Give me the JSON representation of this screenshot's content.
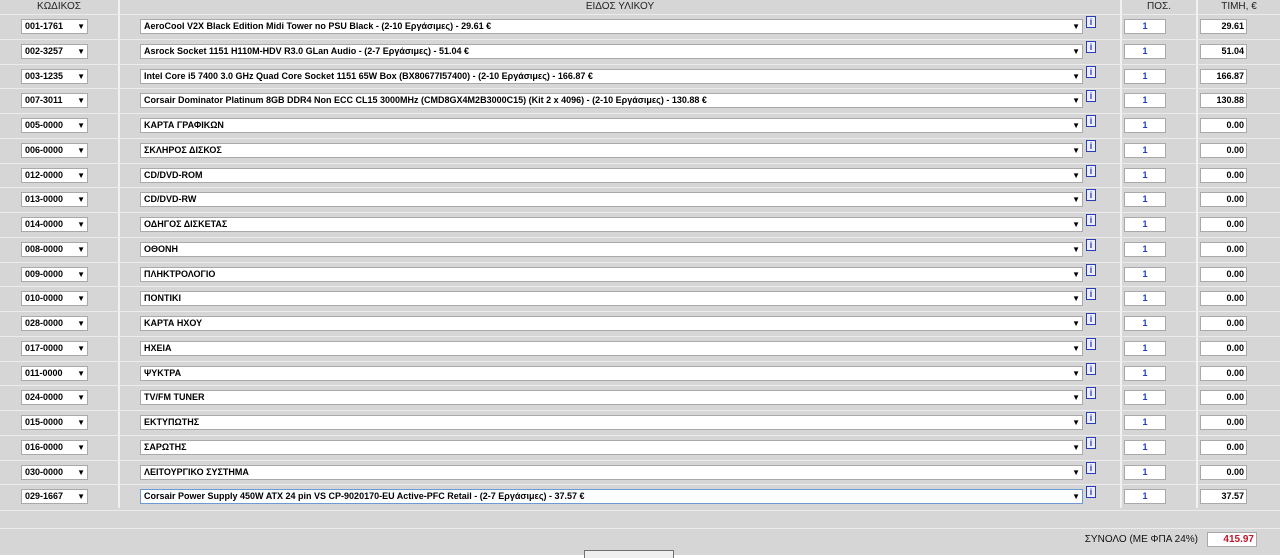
{
  "headers": {
    "code": "ΚΩΔΙΚΟΣ",
    "description": "ΕΙΔΟΣ ΥΛΙΚΟΥ",
    "quantity": "ΠΟΣ.",
    "price": "ΤΙΜΗ, €"
  },
  "rows": [
    {
      "code": "001-1761",
      "description": "AeroCool V2X Black Edition Midi Tower no PSU Black - (2-10 Εργάσιμες) - 29.61 €",
      "qty": "1",
      "price": "29.61"
    },
    {
      "code": "002-3257",
      "description": "Asrock Socket 1151 H110M-HDV R3.0 GLan Audio - (2-7 Εργάσιμες) - 51.04 €",
      "qty": "1",
      "price": "51.04"
    },
    {
      "code": "003-1235",
      "description": "Intel Core i5 7400 3.0 GHz Quad Core Socket 1151 65W Box (BX80677I57400) - (2-10 Εργάσιμες) - 166.87 €",
      "qty": "1",
      "price": "166.87"
    },
    {
      "code": "007-3011",
      "description": "Corsair Dominator Platinum 8GB DDR4 Non ECC CL15 3000MHz (CMD8GX4M2B3000C15) (Kit 2 x 4096) - (2-10 Εργάσιμες) - 130.88 €",
      "qty": "1",
      "price": "130.88"
    },
    {
      "code": "005-0000",
      "description": "ΚΑΡΤΑ ΓΡΑΦΙΚΩΝ",
      "qty": "1",
      "price": "0.00"
    },
    {
      "code": "006-0000",
      "description": "ΣΚΛΗΡΟΣ ΔΙΣΚΟΣ",
      "qty": "1",
      "price": "0.00"
    },
    {
      "code": "012-0000",
      "description": "CD/DVD-ROM",
      "qty": "1",
      "price": "0.00"
    },
    {
      "code": "013-0000",
      "description": "CD/DVD-RW",
      "qty": "1",
      "price": "0.00"
    },
    {
      "code": "014-0000",
      "description": "ΟΔΗΓΟΣ ΔΙΣΚΕΤΑΣ",
      "qty": "1",
      "price": "0.00"
    },
    {
      "code": "008-0000",
      "description": "ΟΘΟΝΗ",
      "qty": "1",
      "price": "0.00"
    },
    {
      "code": "009-0000",
      "description": "ΠΛΗΚΤΡΟΛΟΓΙΟ",
      "qty": "1",
      "price": "0.00"
    },
    {
      "code": "010-0000",
      "description": "ΠΟΝΤΙΚΙ",
      "qty": "1",
      "price": "0.00"
    },
    {
      "code": "028-0000",
      "description": "ΚΑΡΤΑ ΗΧΟΥ",
      "qty": "1",
      "price": "0.00"
    },
    {
      "code": "017-0000",
      "description": "ΗΧΕΙΑ",
      "qty": "1",
      "price": "0.00"
    },
    {
      "code": "011-0000",
      "description": "ΨΥΚΤΡΑ",
      "qty": "1",
      "price": "0.00"
    },
    {
      "code": "024-0000",
      "description": "TV/FM TUNER",
      "qty": "1",
      "price": "0.00"
    },
    {
      "code": "015-0000",
      "description": "ΕΚΤΥΠΩΤΗΣ",
      "qty": "1",
      "price": "0.00"
    },
    {
      "code": "016-0000",
      "description": "ΣΑΡΩΤΗΣ",
      "qty": "1",
      "price": "0.00"
    },
    {
      "code": "030-0000",
      "description": "ΛΕΙΤΟΥΡΓΙΚΟ ΣΥΣΤΗΜΑ",
      "qty": "1",
      "price": "0.00"
    },
    {
      "code": "029-1667",
      "description": "Corsair Power Supply 450W ATX 24 pin VS CP-9020170-EU Active-PFC Retail - (2-7 Εργάσιμες) - 37.57 €",
      "qty": "1",
      "price": "37.57"
    }
  ],
  "info_label": "i",
  "dropdown_arrow": "▼",
  "total": {
    "label": "ΣΥΝΟΛΟ (ΜΕ ΦΠΑ 24%)",
    "value": "415.97"
  },
  "icons": {
    "info": "info-icon",
    "dropdown": "chevron-down-icon"
  },
  "colors": {
    "background": "#d6d6d6",
    "quantity_text": "#1f3fc0",
    "total_text": "#c0182a",
    "info_link": "#2a3eb1"
  }
}
